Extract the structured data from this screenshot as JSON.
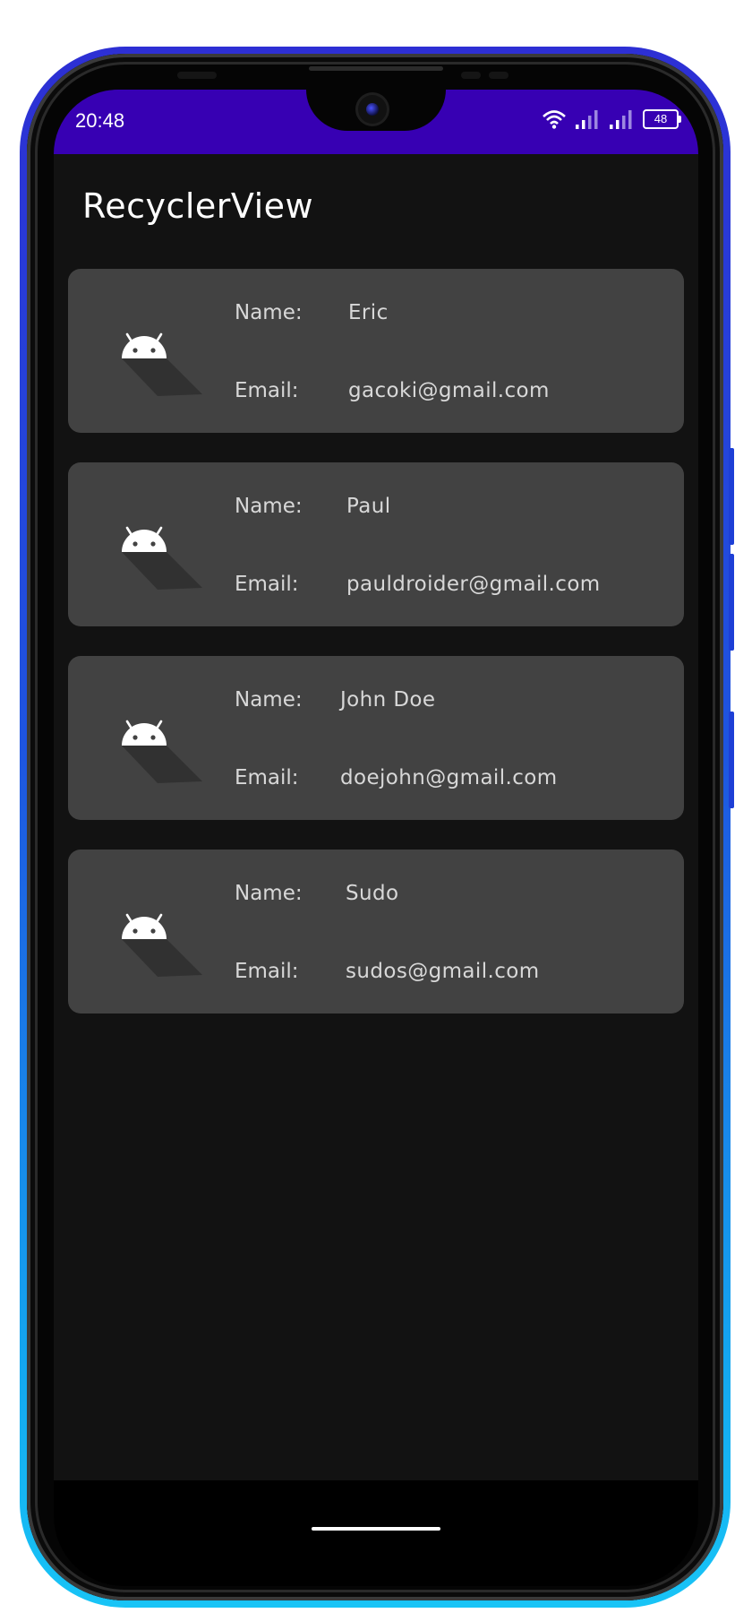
{
  "status_bar": {
    "time": "20:48",
    "battery_level": "48",
    "background_color": "#3700b3",
    "icons": [
      "wifi-icon",
      "signal-icon",
      "signal-icon",
      "battery-icon"
    ]
  },
  "app_bar": {
    "title": "RecyclerView"
  },
  "list": {
    "items": [
      {
        "icon": "android-icon",
        "name_label": "Name:",
        "name": "Eric",
        "email_label": "Email:",
        "email": "gacoki@gmail.com"
      },
      {
        "icon": "android-icon",
        "name_label": "Name:",
        "name": "Paul",
        "email_label": "Email:",
        "email": "pauldroider@gmail.com"
      },
      {
        "icon": "android-icon",
        "name_label": "Name:",
        "name": "John Doe",
        "email_label": "Email:",
        "email": "doejohn@gmail.com"
      },
      {
        "icon": "android-icon",
        "name_label": "Name:",
        "name": "Sudo",
        "email_label": "Email:",
        "email": "sudos@gmail.com"
      }
    ]
  },
  "theme": {
    "screen_background": "#121212",
    "card_background": "#424242",
    "phone_frame_gradient": [
      "#2d2fd4",
      "#18c4f6"
    ]
  }
}
